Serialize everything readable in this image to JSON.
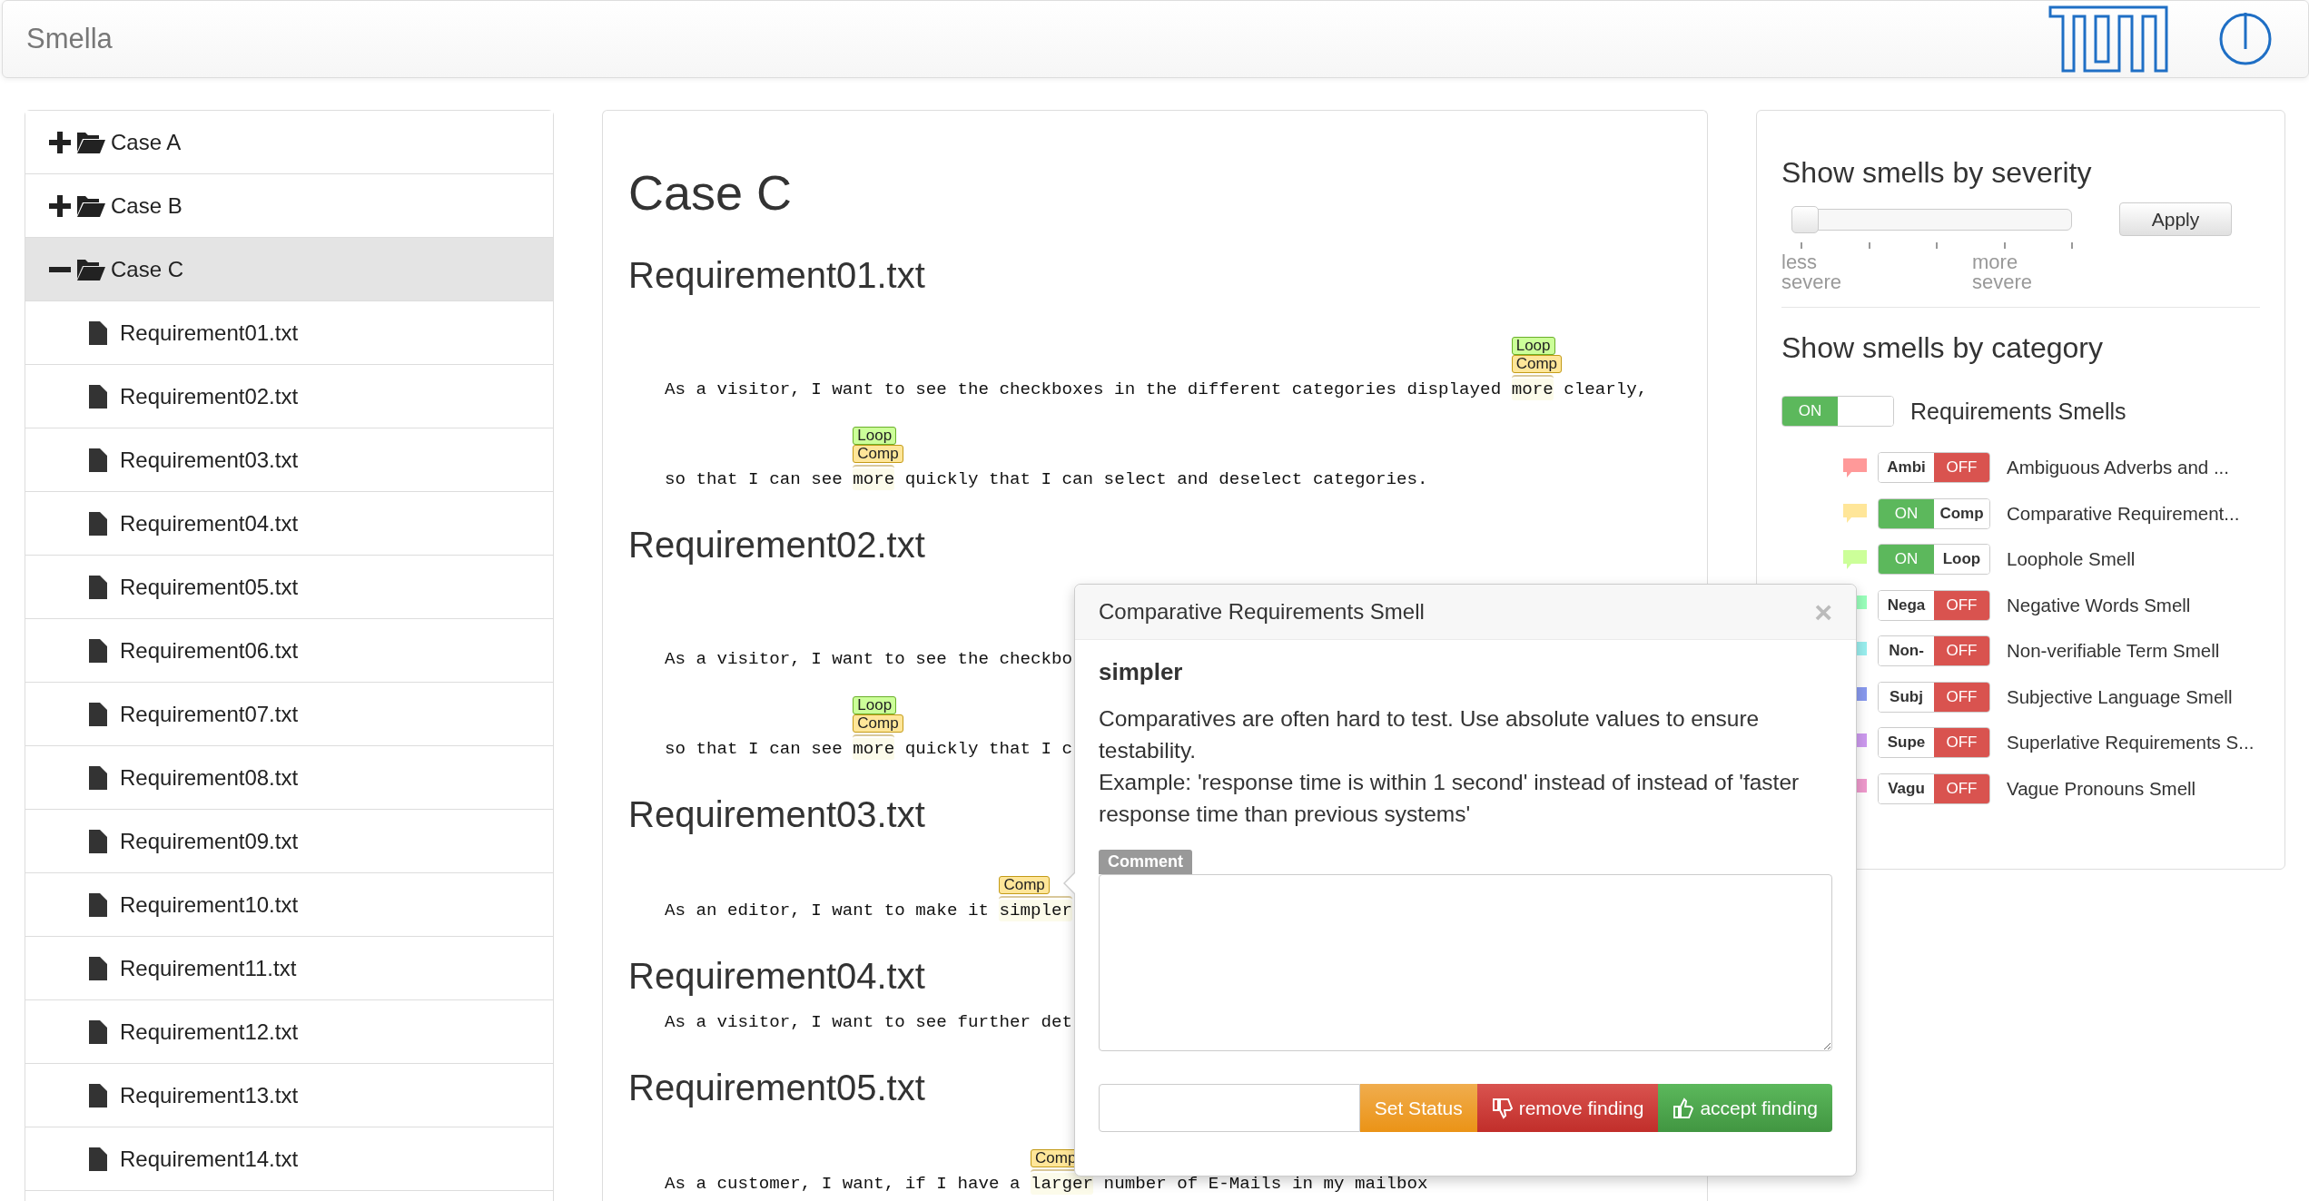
{
  "app": {
    "title": "Smella"
  },
  "tree": [
    {
      "label": "Case A",
      "expanded": false,
      "selected": false
    },
    {
      "label": "Case B",
      "expanded": false,
      "selected": false
    },
    {
      "label": "Case C",
      "expanded": true,
      "selected": true,
      "children": [
        {
          "label": "Requirement01.txt",
          "selected": false
        },
        {
          "label": "Requirement02.txt",
          "selected": false
        },
        {
          "label": "Requirement03.txt",
          "selected": false
        },
        {
          "label": "Requirement04.txt",
          "selected": false
        },
        {
          "label": "Requirement05.txt",
          "selected": false
        },
        {
          "label": "Requirement06.txt",
          "selected": false
        },
        {
          "label": "Requirement07.txt",
          "selected": false
        },
        {
          "label": "Requirement08.txt",
          "selected": false
        },
        {
          "label": "Requirement09.txt",
          "selected": false
        },
        {
          "label": "Requirement10.txt",
          "selected": false
        },
        {
          "label": "Requirement11.txt",
          "selected": false
        },
        {
          "label": "Requirement12.txt",
          "selected": false
        },
        {
          "label": "Requirement13.txt",
          "selected": false
        },
        {
          "label": "Requirement14.txt",
          "selected": false
        }
      ]
    }
  ],
  "document": {
    "title": "Case C",
    "requirements": [
      {
        "title": "Requirement01.txt",
        "lines": [
          [
            {
              "text": "As a visitor, I want to see the checkboxes in the different categories displayed "
            },
            {
              "text": "more",
              "tags": [
                {
                  "kind": "loop",
                  "label": "Loop"
                },
                {
                  "kind": "comp",
                  "label": "Comp"
                }
              ]
            },
            {
              "text": " clearly,"
            }
          ],
          [
            {
              "text": "so that I can see "
            },
            {
              "text": "more",
              "tags": [
                {
                  "kind": "loop",
                  "label": "Loop"
                },
                {
                  "kind": "comp",
                  "label": "Comp"
                }
              ]
            },
            {
              "text": " quickly that I can select and deselect categories."
            }
          ]
        ]
      },
      {
        "title": "Requirement02.txt",
        "lines": [
          [
            {
              "text": "As a visitor, I want to see the checkbo"
            }
          ],
          [
            {
              "text": "so that I can see "
            },
            {
              "text": "more",
              "tags": [
                {
                  "kind": "loop",
                  "label": "Loop"
                },
                {
                  "kind": "comp",
                  "label": "Comp"
                }
              ]
            },
            {
              "text": " quickly that I c"
            }
          ]
        ]
      },
      {
        "title": "Requirement03.txt",
        "lines": [
          [
            {
              "text": "As an editor, I want to make it "
            },
            {
              "text": "simpler",
              "tags": [
                {
                  "kind": "comp",
                  "label": "Comp"
                }
              ]
            }
          ]
        ]
      },
      {
        "title": "Requirement04.txt",
        "lines": [
          [
            {
              "text": "As a visitor, I want to see further det"
            }
          ]
        ]
      },
      {
        "title": "Requirement05.txt",
        "lines": [
          [
            {
              "text": "As a customer, I want, if I have a "
            },
            {
              "text": "larger",
              "tags": [
                {
                  "kind": "comp",
                  "label": "Comp"
                }
              ]
            },
            {
              "text": " number of E-Mails in my mailbox"
            }
          ]
        ]
      }
    ]
  },
  "severity": {
    "title": "Show smells by severity",
    "level": 0,
    "min_label": "less severe",
    "max_label": "more severe",
    "apply": "Apply"
  },
  "category": {
    "title": "Show smells by category",
    "master": {
      "label": "Requirements Smells",
      "on": true,
      "switch_text": "ON"
    },
    "smells": [
      {
        "abbr": "Ambi",
        "label": "Ambiguous Adverbs and ...",
        "on": false,
        "switch_text": "OFF",
        "color": "#ff9999"
      },
      {
        "abbr": "Comp",
        "label": "Comparative Requirement...",
        "on": true,
        "switch_text": "ON",
        "color": "#ffe699"
      },
      {
        "abbr": "Loop",
        "label": "Loophole Smell",
        "on": true,
        "switch_text": "ON",
        "color": "#ccff99"
      },
      {
        "abbr": "Nega",
        "label": "Negative Words Smell",
        "on": false,
        "switch_text": "OFF",
        "color": "#99ffbb"
      },
      {
        "abbr": "Non-",
        "label": "Non-verifiable Term Smell",
        "on": false,
        "switch_text": "OFF",
        "color": "#99eeee"
      },
      {
        "abbr": "Subj",
        "label": "Subjective Language Smell",
        "on": false,
        "switch_text": "OFF",
        "color": "#8899ee"
      },
      {
        "abbr": "Supe",
        "label": "Superlative Requirements S...",
        "on": false,
        "switch_text": "OFF",
        "color": "#cc99ee"
      },
      {
        "abbr": "Vagu",
        "label": "Vague Pronouns Smell",
        "on": false,
        "switch_text": "OFF",
        "color": "#ee99cc"
      }
    ]
  },
  "popup": {
    "title": "Comparative Requirements Smell",
    "close": "×",
    "word": "simpler",
    "description": [
      "Comparatives are often hard to test. Use absolute values to ensure testability.",
      "Example: 'response time is within 1 second' instead of instead of 'faster response time than previous systems'"
    ],
    "comment_label": "Comment",
    "set_status": "Set Status",
    "remove": "remove finding",
    "accept": "accept finding"
  }
}
